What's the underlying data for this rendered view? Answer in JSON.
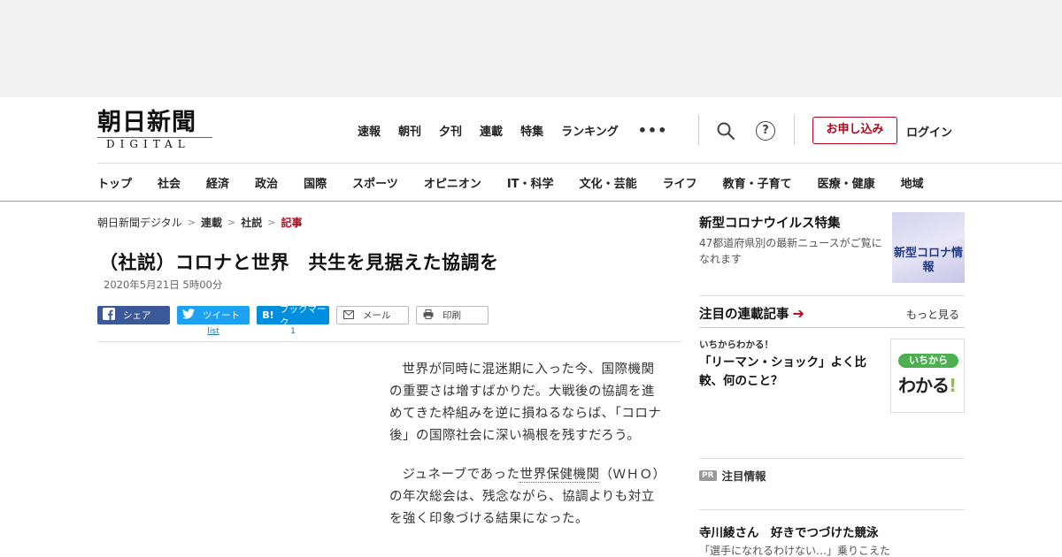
{
  "header": {
    "logo_main": "朝日新聞",
    "logo_sub": "DIGITAL",
    "nav": [
      "速報",
      "朝刊",
      "夕刊",
      "連載",
      "特集",
      "ランキング"
    ],
    "more": "•••",
    "help_symbol": "?",
    "apply_label": "お申し込み",
    "login_label": "ログイン"
  },
  "categories": [
    "トップ",
    "社会",
    "経済",
    "政治",
    "国際",
    "スポーツ",
    "オピニオン",
    "IT・科学",
    "文化・芸能",
    "ライフ",
    "教育・子育て",
    "医療・健康",
    "地域"
  ],
  "breadcrumb": [
    "朝日新聞デジタル",
    "連載",
    "社説",
    "記事"
  ],
  "article": {
    "title": "（社説）コロナと世界　共生を見据えた協調を",
    "date": "2020年5月21日 5時00分",
    "p1": "世界が同時に混迷期に入った今、国際機関の重要さは増すばかりだ。大戦後の協調を進めてきた枠組みを逆に損ねるならば、「コロナ後」の国際社会に深い禍根を残すだろう。",
    "p2_a": "ジュネーブであった",
    "p2_link": "世界保健機関",
    "p2_b": "（ＷＨＯ）の年次総会は、残念ながら、協調よりも対立を強く印象づける結果になった。"
  },
  "share": {
    "facebook": "シェア",
    "twitter": "ツイート",
    "twitter_count": "list",
    "hatena": "ブックマーク",
    "hatena_count": "1",
    "mail": "メール",
    "print": "印刷"
  },
  "sidebar": {
    "corona_title": "新型コロナウイルス特集",
    "corona_desc": "47都道府県別の最新ニュースがご覧になれます",
    "corona_thumb": "新型コロナ情報",
    "series_head": "注目の連載記事",
    "more_link": "もっと見る",
    "series_kicker": "いちからわかる！",
    "series_title": "「リーマン・ショック」よく比較、何のこと？",
    "ichi_top": "いちから",
    "ichi_bottom": "わかる",
    "pr_badge": "PR",
    "pr_label": "注目情報",
    "promo_title": "寺川綾さん　好きでつづけた競泳",
    "promo_sub": "「選手になれるわけない…」乗りこえた"
  },
  "colors": {
    "brand_red": "#b5051a",
    "facebook_blue": "#3b5998",
    "twitter_blue": "#1da1f2",
    "hatena_blue": "#008fde"
  }
}
